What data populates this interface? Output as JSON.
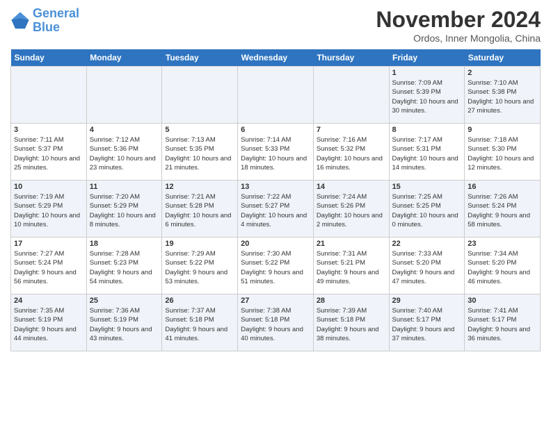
{
  "header": {
    "logo_line1": "General",
    "logo_line2": "Blue",
    "title": "November 2024",
    "location": "Ordos, Inner Mongolia, China"
  },
  "days_of_week": [
    "Sunday",
    "Monday",
    "Tuesday",
    "Wednesday",
    "Thursday",
    "Friday",
    "Saturday"
  ],
  "weeks": [
    [
      {
        "day": "",
        "info": ""
      },
      {
        "day": "",
        "info": ""
      },
      {
        "day": "",
        "info": ""
      },
      {
        "day": "",
        "info": ""
      },
      {
        "day": "",
        "info": ""
      },
      {
        "day": "1",
        "info": "Sunrise: 7:09 AM\nSunset: 5:39 PM\nDaylight: 10 hours and 30 minutes."
      },
      {
        "day": "2",
        "info": "Sunrise: 7:10 AM\nSunset: 5:38 PM\nDaylight: 10 hours and 27 minutes."
      }
    ],
    [
      {
        "day": "3",
        "info": "Sunrise: 7:11 AM\nSunset: 5:37 PM\nDaylight: 10 hours and 25 minutes."
      },
      {
        "day": "4",
        "info": "Sunrise: 7:12 AM\nSunset: 5:36 PM\nDaylight: 10 hours and 23 minutes."
      },
      {
        "day": "5",
        "info": "Sunrise: 7:13 AM\nSunset: 5:35 PM\nDaylight: 10 hours and 21 minutes."
      },
      {
        "day": "6",
        "info": "Sunrise: 7:14 AM\nSunset: 5:33 PM\nDaylight: 10 hours and 18 minutes."
      },
      {
        "day": "7",
        "info": "Sunrise: 7:16 AM\nSunset: 5:32 PM\nDaylight: 10 hours and 16 minutes."
      },
      {
        "day": "8",
        "info": "Sunrise: 7:17 AM\nSunset: 5:31 PM\nDaylight: 10 hours and 14 minutes."
      },
      {
        "day": "9",
        "info": "Sunrise: 7:18 AM\nSunset: 5:30 PM\nDaylight: 10 hours and 12 minutes."
      }
    ],
    [
      {
        "day": "10",
        "info": "Sunrise: 7:19 AM\nSunset: 5:29 PM\nDaylight: 10 hours and 10 minutes."
      },
      {
        "day": "11",
        "info": "Sunrise: 7:20 AM\nSunset: 5:29 PM\nDaylight: 10 hours and 8 minutes."
      },
      {
        "day": "12",
        "info": "Sunrise: 7:21 AM\nSunset: 5:28 PM\nDaylight: 10 hours and 6 minutes."
      },
      {
        "day": "13",
        "info": "Sunrise: 7:22 AM\nSunset: 5:27 PM\nDaylight: 10 hours and 4 minutes."
      },
      {
        "day": "14",
        "info": "Sunrise: 7:24 AM\nSunset: 5:26 PM\nDaylight: 10 hours and 2 minutes."
      },
      {
        "day": "15",
        "info": "Sunrise: 7:25 AM\nSunset: 5:25 PM\nDaylight: 10 hours and 0 minutes."
      },
      {
        "day": "16",
        "info": "Sunrise: 7:26 AM\nSunset: 5:24 PM\nDaylight: 9 hours and 58 minutes."
      }
    ],
    [
      {
        "day": "17",
        "info": "Sunrise: 7:27 AM\nSunset: 5:24 PM\nDaylight: 9 hours and 56 minutes."
      },
      {
        "day": "18",
        "info": "Sunrise: 7:28 AM\nSunset: 5:23 PM\nDaylight: 9 hours and 54 minutes."
      },
      {
        "day": "19",
        "info": "Sunrise: 7:29 AM\nSunset: 5:22 PM\nDaylight: 9 hours and 53 minutes."
      },
      {
        "day": "20",
        "info": "Sunrise: 7:30 AM\nSunset: 5:22 PM\nDaylight: 9 hours and 51 minutes."
      },
      {
        "day": "21",
        "info": "Sunrise: 7:31 AM\nSunset: 5:21 PM\nDaylight: 9 hours and 49 minutes."
      },
      {
        "day": "22",
        "info": "Sunrise: 7:33 AM\nSunset: 5:20 PM\nDaylight: 9 hours and 47 minutes."
      },
      {
        "day": "23",
        "info": "Sunrise: 7:34 AM\nSunset: 5:20 PM\nDaylight: 9 hours and 46 minutes."
      }
    ],
    [
      {
        "day": "24",
        "info": "Sunrise: 7:35 AM\nSunset: 5:19 PM\nDaylight: 9 hours and 44 minutes."
      },
      {
        "day": "25",
        "info": "Sunrise: 7:36 AM\nSunset: 5:19 PM\nDaylight: 9 hours and 43 minutes."
      },
      {
        "day": "26",
        "info": "Sunrise: 7:37 AM\nSunset: 5:18 PM\nDaylight: 9 hours and 41 minutes."
      },
      {
        "day": "27",
        "info": "Sunrise: 7:38 AM\nSunset: 5:18 PM\nDaylight: 9 hours and 40 minutes."
      },
      {
        "day": "28",
        "info": "Sunrise: 7:39 AM\nSunset: 5:18 PM\nDaylight: 9 hours and 38 minutes."
      },
      {
        "day": "29",
        "info": "Sunrise: 7:40 AM\nSunset: 5:17 PM\nDaylight: 9 hours and 37 minutes."
      },
      {
        "day": "30",
        "info": "Sunrise: 7:41 AM\nSunset: 5:17 PM\nDaylight: 9 hours and 36 minutes."
      }
    ]
  ]
}
